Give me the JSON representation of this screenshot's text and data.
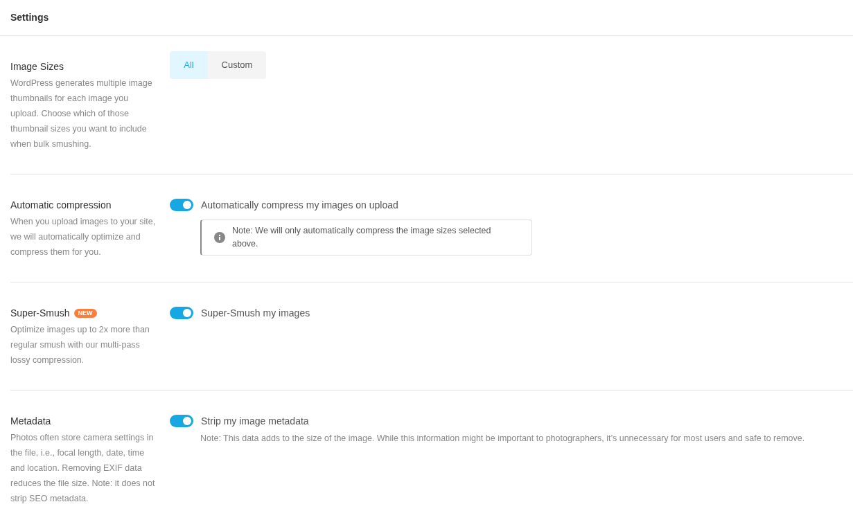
{
  "header": {
    "title": "Settings"
  },
  "sections": [
    {
      "title": "Image Sizes",
      "description": "WordPress generates multiple image thumbnails for each image you upload. Choose which of those thumbnail sizes you want to include when bulk smushing.",
      "control": {
        "kind": "segmented",
        "options": [
          {
            "label": "All",
            "selected": true
          },
          {
            "label": "Custom",
            "selected": false
          }
        ]
      }
    },
    {
      "title": "Automatic compression",
      "description": "When you upload images to your site, we will automatically optimize and compress them for you.",
      "control": {
        "kind": "toggle",
        "on": true,
        "label": "Automatically compress my images on upload",
        "notice": "Note: We will only automatically compress the image sizes selected above."
      }
    },
    {
      "title": "Super-Smush",
      "badge": "NEW",
      "description": "Optimize images up to 2x more than regular smush with our multi-pass lossy compression.",
      "control": {
        "kind": "toggle",
        "on": true,
        "label": "Super-Smush my images"
      }
    },
    {
      "title": "Metadata",
      "description": "Photos often store camera settings in the file, i.e., focal length, date, time and location. Removing EXIF data reduces the file size. Note: it does not strip SEO metadata.",
      "control": {
        "kind": "toggle",
        "on": true,
        "label": "Strip my image metadata",
        "note": "Note: This data adds to the size of the image. While this information might be important to photographers, it’s unnecessary for most users and safe to remove."
      }
    }
  ]
}
